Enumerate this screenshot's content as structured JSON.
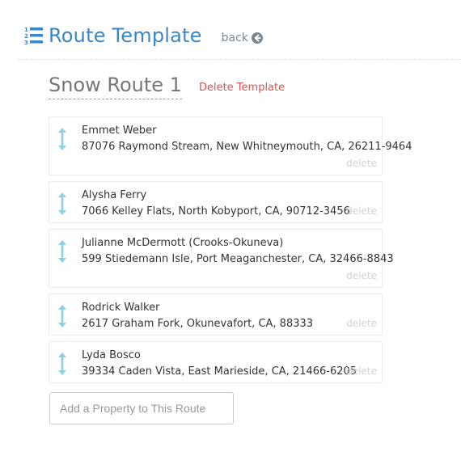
{
  "header": {
    "title": "Route Template",
    "back_label": "back",
    "icons": {
      "title_icon": "ordered-list-icon",
      "back_icon": "arrow-circle-left-icon"
    },
    "colors": {
      "title": "#3a86c8",
      "back": "#7a8791"
    }
  },
  "route": {
    "name": "Snow Route 1",
    "delete_template_label": "Delete Template",
    "delete_color": "#d9534f"
  },
  "stops": [
    {
      "name": "Emmet Weber",
      "address": "87076 Raymond Stream, New Whitneymouth, CA, 26211-9464",
      "delete_label": "delete"
    },
    {
      "name": "Alysha Ferry",
      "address": "7066 Kelley Flats, North Kobyport, CA, 90712-3456",
      "delete_label": "delete"
    },
    {
      "name": "Julianne McDermott (Crooks-Okuneva)",
      "address": "599 Stiedemann Isle, Port Meaganchester, CA, 32466-8843",
      "delete_label": "delete"
    },
    {
      "name": "Rodrick Walker",
      "address": "2617 Graham Fork, Okunevafort, CA, 88333",
      "delete_label": "delete"
    },
    {
      "name": "Lyda Bosco",
      "address": "39334 Caden Vista, East Marieside, CA, 21466-6205",
      "delete_label": "delete"
    }
  ],
  "stop_icon": "vertical-arrows-drag-icon",
  "drag_color": "#8ecfe0",
  "add_property": {
    "placeholder": "Add a Property to This Route",
    "value": ""
  }
}
